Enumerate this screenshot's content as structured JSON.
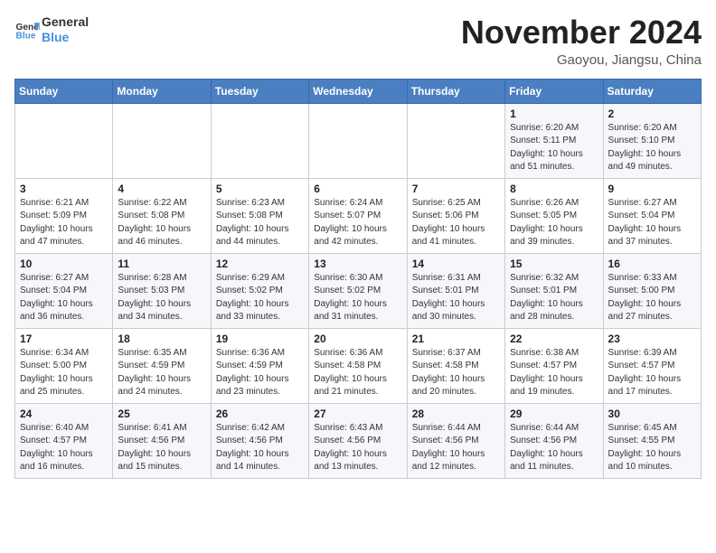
{
  "header": {
    "logo_line1": "General",
    "logo_line2": "Blue",
    "month": "November 2024",
    "location": "Gaoyou, Jiangsu, China"
  },
  "weekdays": [
    "Sunday",
    "Monday",
    "Tuesday",
    "Wednesday",
    "Thursday",
    "Friday",
    "Saturday"
  ],
  "weeks": [
    [
      {
        "day": "",
        "info": ""
      },
      {
        "day": "",
        "info": ""
      },
      {
        "day": "",
        "info": ""
      },
      {
        "day": "",
        "info": ""
      },
      {
        "day": "",
        "info": ""
      },
      {
        "day": "1",
        "info": "Sunrise: 6:20 AM\nSunset: 5:11 PM\nDaylight: 10 hours and 51 minutes."
      },
      {
        "day": "2",
        "info": "Sunrise: 6:20 AM\nSunset: 5:10 PM\nDaylight: 10 hours and 49 minutes."
      }
    ],
    [
      {
        "day": "3",
        "info": "Sunrise: 6:21 AM\nSunset: 5:09 PM\nDaylight: 10 hours and 47 minutes."
      },
      {
        "day": "4",
        "info": "Sunrise: 6:22 AM\nSunset: 5:08 PM\nDaylight: 10 hours and 46 minutes."
      },
      {
        "day": "5",
        "info": "Sunrise: 6:23 AM\nSunset: 5:08 PM\nDaylight: 10 hours and 44 minutes."
      },
      {
        "day": "6",
        "info": "Sunrise: 6:24 AM\nSunset: 5:07 PM\nDaylight: 10 hours and 42 minutes."
      },
      {
        "day": "7",
        "info": "Sunrise: 6:25 AM\nSunset: 5:06 PM\nDaylight: 10 hours and 41 minutes."
      },
      {
        "day": "8",
        "info": "Sunrise: 6:26 AM\nSunset: 5:05 PM\nDaylight: 10 hours and 39 minutes."
      },
      {
        "day": "9",
        "info": "Sunrise: 6:27 AM\nSunset: 5:04 PM\nDaylight: 10 hours and 37 minutes."
      }
    ],
    [
      {
        "day": "10",
        "info": "Sunrise: 6:27 AM\nSunset: 5:04 PM\nDaylight: 10 hours and 36 minutes."
      },
      {
        "day": "11",
        "info": "Sunrise: 6:28 AM\nSunset: 5:03 PM\nDaylight: 10 hours and 34 minutes."
      },
      {
        "day": "12",
        "info": "Sunrise: 6:29 AM\nSunset: 5:02 PM\nDaylight: 10 hours and 33 minutes."
      },
      {
        "day": "13",
        "info": "Sunrise: 6:30 AM\nSunset: 5:02 PM\nDaylight: 10 hours and 31 minutes."
      },
      {
        "day": "14",
        "info": "Sunrise: 6:31 AM\nSunset: 5:01 PM\nDaylight: 10 hours and 30 minutes."
      },
      {
        "day": "15",
        "info": "Sunrise: 6:32 AM\nSunset: 5:01 PM\nDaylight: 10 hours and 28 minutes."
      },
      {
        "day": "16",
        "info": "Sunrise: 6:33 AM\nSunset: 5:00 PM\nDaylight: 10 hours and 27 minutes."
      }
    ],
    [
      {
        "day": "17",
        "info": "Sunrise: 6:34 AM\nSunset: 5:00 PM\nDaylight: 10 hours and 25 minutes."
      },
      {
        "day": "18",
        "info": "Sunrise: 6:35 AM\nSunset: 4:59 PM\nDaylight: 10 hours and 24 minutes."
      },
      {
        "day": "19",
        "info": "Sunrise: 6:36 AM\nSunset: 4:59 PM\nDaylight: 10 hours and 23 minutes."
      },
      {
        "day": "20",
        "info": "Sunrise: 6:36 AM\nSunset: 4:58 PM\nDaylight: 10 hours and 21 minutes."
      },
      {
        "day": "21",
        "info": "Sunrise: 6:37 AM\nSunset: 4:58 PM\nDaylight: 10 hours and 20 minutes."
      },
      {
        "day": "22",
        "info": "Sunrise: 6:38 AM\nSunset: 4:57 PM\nDaylight: 10 hours and 19 minutes."
      },
      {
        "day": "23",
        "info": "Sunrise: 6:39 AM\nSunset: 4:57 PM\nDaylight: 10 hours and 17 minutes."
      }
    ],
    [
      {
        "day": "24",
        "info": "Sunrise: 6:40 AM\nSunset: 4:57 PM\nDaylight: 10 hours and 16 minutes."
      },
      {
        "day": "25",
        "info": "Sunrise: 6:41 AM\nSunset: 4:56 PM\nDaylight: 10 hours and 15 minutes."
      },
      {
        "day": "26",
        "info": "Sunrise: 6:42 AM\nSunset: 4:56 PM\nDaylight: 10 hours and 14 minutes."
      },
      {
        "day": "27",
        "info": "Sunrise: 6:43 AM\nSunset: 4:56 PM\nDaylight: 10 hours and 13 minutes."
      },
      {
        "day": "28",
        "info": "Sunrise: 6:44 AM\nSunset: 4:56 PM\nDaylight: 10 hours and 12 minutes."
      },
      {
        "day": "29",
        "info": "Sunrise: 6:44 AM\nSunset: 4:56 PM\nDaylight: 10 hours and 11 minutes."
      },
      {
        "day": "30",
        "info": "Sunrise: 6:45 AM\nSunset: 4:55 PM\nDaylight: 10 hours and 10 minutes."
      }
    ]
  ]
}
